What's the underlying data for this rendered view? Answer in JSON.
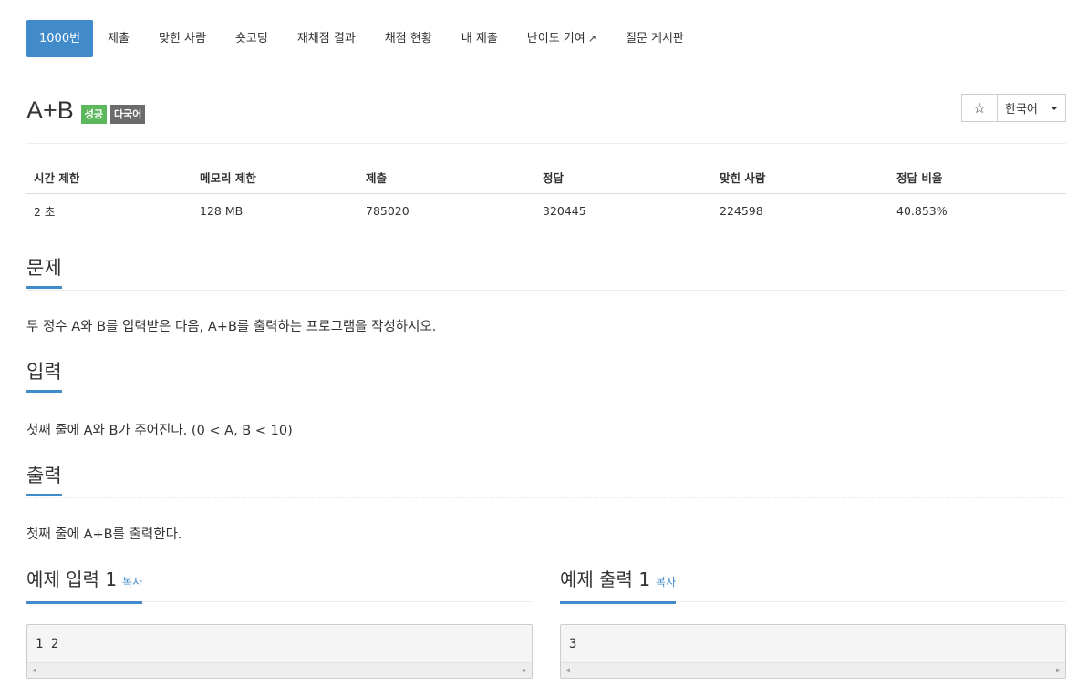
{
  "nav": {
    "tabs": [
      {
        "label": "1000번"
      },
      {
        "label": "제출"
      },
      {
        "label": "맞힌 사람"
      },
      {
        "label": "숏코딩"
      },
      {
        "label": "재채점 결과"
      },
      {
        "label": "채점 현황"
      },
      {
        "label": "내 제출"
      },
      {
        "label": "난이도 기여"
      },
      {
        "label": "질문 게시판"
      }
    ],
    "external_icon": "external-link-icon",
    "active_index": 0,
    "active_color": "#428bca"
  },
  "problem": {
    "title": "A+B",
    "badges": {
      "success": "성공",
      "multi_lang": "다국어"
    },
    "badge_colors": {
      "success": "#5cb85c",
      "multi_lang": "#6b6b6b"
    },
    "star_icon": "☆",
    "language": "한국어"
  },
  "info": {
    "headers": [
      "시간 제한",
      "메모리 제한",
      "제출",
      "정답",
      "맞힌 사람",
      "정답 비율"
    ],
    "values": [
      "2 초",
      "128 MB",
      "785020",
      "320445",
      "224598",
      "40.853%"
    ]
  },
  "sections": {
    "problem": {
      "heading": "문제",
      "text": "두 정수 A와 B를 입력받은 다음, A+B를 출력하는 프로그램을 작성하시오."
    },
    "input": {
      "heading": "입력",
      "text": "첫째 줄에 A와 B가 주어진다. (0 < A, B < 10)"
    },
    "output": {
      "heading": "출력",
      "text": "첫째 줄에 A+B를 출력한다."
    }
  },
  "samples": {
    "input": {
      "heading": "예제 입력 1",
      "copy": "복사",
      "content": "1 2"
    },
    "output": {
      "heading": "예제 출력 1",
      "copy": "복사",
      "content": "3"
    }
  }
}
